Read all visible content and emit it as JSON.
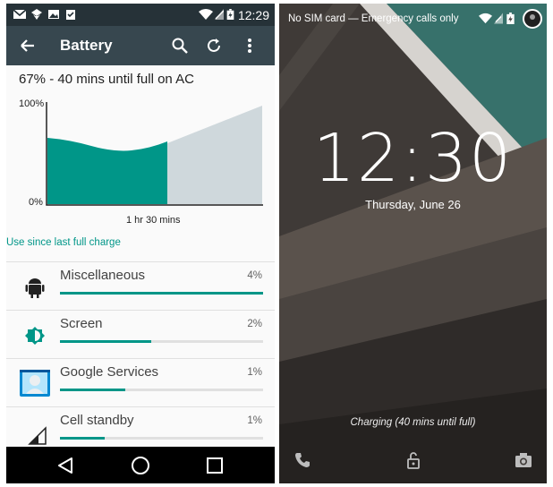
{
  "left": {
    "status_bar": {
      "time": "12:29",
      "icons": [
        "gmail-icon",
        "dropbox-icon",
        "image-icon",
        "clipboard-check-icon",
        "wifi-icon",
        "signal-icon",
        "battery-charging-icon"
      ]
    },
    "toolbar": {
      "title": "Battery",
      "icons": [
        "back-arrow-icon",
        "search-icon",
        "refresh-icon",
        "overflow-menu-icon"
      ]
    },
    "summary": "67% - 40 mins until full on AC",
    "chart": {
      "y_top_label": "100%",
      "y_bottom_label": "0%",
      "x_label": "1 hr 30 mins",
      "fill_color": "#009688",
      "projection_color": "#cfd8dc"
    },
    "usage_link": "Use since last full charge",
    "apps": [
      {
        "name": "Miscellaneous",
        "percent": "4%",
        "fraction": 1.0,
        "icon": "android-icon"
      },
      {
        "name": "Screen",
        "percent": "2%",
        "fraction": 0.45,
        "icon": "brightness-icon"
      },
      {
        "name": "Google Services",
        "percent": "1%",
        "fraction": 0.32,
        "icon": "google-services-icon"
      },
      {
        "name": "Cell standby",
        "percent": "1%",
        "fraction": 0.22,
        "icon": "cell-signal-icon"
      }
    ],
    "nav": [
      "back-nav-icon",
      "home-nav-icon",
      "recents-nav-icon"
    ]
  },
  "right": {
    "status_bar": {
      "carrier": "No SIM card — Emergency calls only",
      "icons": [
        "wifi-icon",
        "signal-icon",
        "battery-charging-icon",
        "avatar"
      ]
    },
    "time": "12:30",
    "date": "Thursday, June 26",
    "charging": "Charging (40 mins until full)",
    "bottom_icons": [
      "phone-icon",
      "unlock-icon",
      "camera-icon"
    ]
  },
  "colors": {
    "accent": "#009688",
    "toolbar": "#37474f",
    "status_bar": "#263238"
  }
}
